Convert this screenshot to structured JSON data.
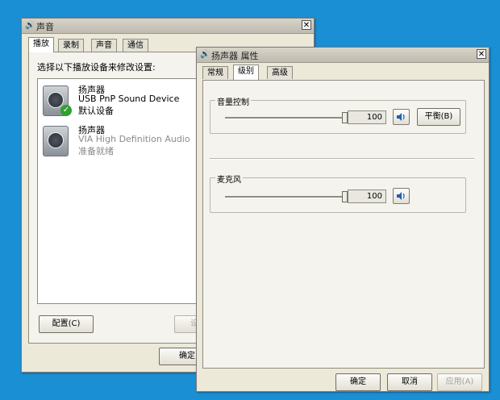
{
  "sound_dialog": {
    "title": "声音",
    "tabs": [
      "播放",
      "录制",
      "声音",
      "通信"
    ],
    "instruction": "选择以下播放设备来修改设置:",
    "devices": [
      {
        "name": "扬声器",
        "detail": "USB PnP Sound Device",
        "status": "默认设备"
      },
      {
        "name": "扬声器",
        "detail": "VIA High Definition Audio",
        "status": "准备就绪"
      }
    ],
    "configure_button": "配置(C)",
    "set_default_button": "设为",
    "ok_button": "确定"
  },
  "props_dialog": {
    "title": "扬声器 属性",
    "tabs": [
      "常规",
      "级别",
      "高级"
    ],
    "volume_group": {
      "label": "音量控制",
      "value": "100",
      "balance_button": "平衡(B)"
    },
    "mic_group": {
      "label": "麦克风",
      "value": "100"
    },
    "ok_button": "确定",
    "cancel_button": "取消",
    "apply_button": "应用(A)"
  },
  "icons": {
    "window": "speaker-window-icon",
    "speaker": "speaker-volume-icon",
    "default_check": "checkmark-icon"
  }
}
